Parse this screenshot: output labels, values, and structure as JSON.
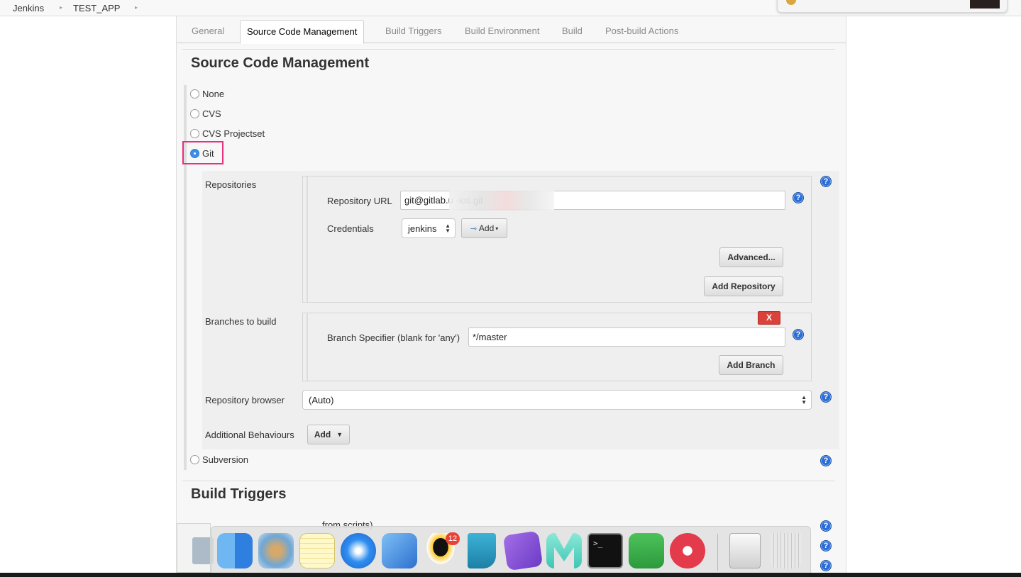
{
  "breadcrumb": {
    "root": "Jenkins",
    "job": "TEST_APP"
  },
  "tabs": [
    "General",
    "Source Code Management",
    "Build Triggers",
    "Build Environment",
    "Build",
    "Post-build Actions"
  ],
  "scm": {
    "title": "Source Code Management",
    "options": {
      "none": "None",
      "cvs": "CVS",
      "cvs_projectset": "CVS Projectset",
      "git": "Git",
      "subversion": "Subversion"
    },
    "selected": "Git",
    "git": {
      "repositories_label": "Repositories",
      "repo_url_label": "Repository URL",
      "repo_url_value": "git@gitlab.u                                              -ios.git",
      "credentials_label": "Credentials",
      "credentials_value": "jenkins",
      "add_credentials_label": "Add",
      "advanced_label": "Advanced...",
      "add_repository_label": "Add Repository",
      "branches_label": "Branches to build",
      "delete_label": "X",
      "branch_spec_label": "Branch Specifier (blank for 'any')",
      "branch_spec_value": "*/master",
      "add_branch_label": "Add Branch",
      "repo_browser_label": "Repository browser",
      "repo_browser_value": "(Auto)",
      "additional_label": "Additional Behaviours",
      "additional_add_label": "Add"
    }
  },
  "build_triggers": {
    "title": "Build Triggers",
    "trigger_remote_label": "Trigger builds remotely (e.g., from scripts)",
    "trigger_remote_visible_suffix": "from scripts)"
  },
  "help_icon_glyph": "?",
  "dock": {
    "apps": [
      "finder",
      "mail",
      "notes",
      "safari",
      "xcode",
      "qq",
      "l-app",
      "omnifocus",
      "m-app",
      "terminal",
      "evernote",
      "pocket",
      "disk-utility",
      "trash"
    ],
    "qq_badge": "12"
  },
  "colors": {
    "highlight": "#e8317c",
    "help": "#2a6dd8",
    "delete": "#d9413a"
  }
}
